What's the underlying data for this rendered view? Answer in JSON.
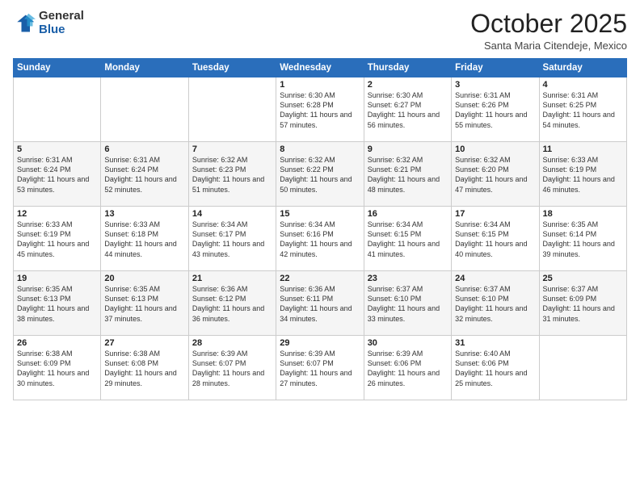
{
  "logo": {
    "general": "General",
    "blue": "Blue"
  },
  "title": "October 2025",
  "location": "Santa Maria Citendeje, Mexico",
  "days_of_week": [
    "Sunday",
    "Monday",
    "Tuesday",
    "Wednesday",
    "Thursday",
    "Friday",
    "Saturday"
  ],
  "weeks": [
    [
      {
        "day": "",
        "sunrise": "",
        "sunset": "",
        "daylight": ""
      },
      {
        "day": "",
        "sunrise": "",
        "sunset": "",
        "daylight": ""
      },
      {
        "day": "",
        "sunrise": "",
        "sunset": "",
        "daylight": ""
      },
      {
        "day": "1",
        "sunrise": "Sunrise: 6:30 AM",
        "sunset": "Sunset: 6:28 PM",
        "daylight": "Daylight: 11 hours and 57 minutes."
      },
      {
        "day": "2",
        "sunrise": "Sunrise: 6:30 AM",
        "sunset": "Sunset: 6:27 PM",
        "daylight": "Daylight: 11 hours and 56 minutes."
      },
      {
        "day": "3",
        "sunrise": "Sunrise: 6:31 AM",
        "sunset": "Sunset: 6:26 PM",
        "daylight": "Daylight: 11 hours and 55 minutes."
      },
      {
        "day": "4",
        "sunrise": "Sunrise: 6:31 AM",
        "sunset": "Sunset: 6:25 PM",
        "daylight": "Daylight: 11 hours and 54 minutes."
      }
    ],
    [
      {
        "day": "5",
        "sunrise": "Sunrise: 6:31 AM",
        "sunset": "Sunset: 6:24 PM",
        "daylight": "Daylight: 11 hours and 53 minutes."
      },
      {
        "day": "6",
        "sunrise": "Sunrise: 6:31 AM",
        "sunset": "Sunset: 6:24 PM",
        "daylight": "Daylight: 11 hours and 52 minutes."
      },
      {
        "day": "7",
        "sunrise": "Sunrise: 6:32 AM",
        "sunset": "Sunset: 6:23 PM",
        "daylight": "Daylight: 11 hours and 51 minutes."
      },
      {
        "day": "8",
        "sunrise": "Sunrise: 6:32 AM",
        "sunset": "Sunset: 6:22 PM",
        "daylight": "Daylight: 11 hours and 50 minutes."
      },
      {
        "day": "9",
        "sunrise": "Sunrise: 6:32 AM",
        "sunset": "Sunset: 6:21 PM",
        "daylight": "Daylight: 11 hours and 48 minutes."
      },
      {
        "day": "10",
        "sunrise": "Sunrise: 6:32 AM",
        "sunset": "Sunset: 6:20 PM",
        "daylight": "Daylight: 11 hours and 47 minutes."
      },
      {
        "day": "11",
        "sunrise": "Sunrise: 6:33 AM",
        "sunset": "Sunset: 6:19 PM",
        "daylight": "Daylight: 11 hours and 46 minutes."
      }
    ],
    [
      {
        "day": "12",
        "sunrise": "Sunrise: 6:33 AM",
        "sunset": "Sunset: 6:19 PM",
        "daylight": "Daylight: 11 hours and 45 minutes."
      },
      {
        "day": "13",
        "sunrise": "Sunrise: 6:33 AM",
        "sunset": "Sunset: 6:18 PM",
        "daylight": "Daylight: 11 hours and 44 minutes."
      },
      {
        "day": "14",
        "sunrise": "Sunrise: 6:34 AM",
        "sunset": "Sunset: 6:17 PM",
        "daylight": "Daylight: 11 hours and 43 minutes."
      },
      {
        "day": "15",
        "sunrise": "Sunrise: 6:34 AM",
        "sunset": "Sunset: 6:16 PM",
        "daylight": "Daylight: 11 hours and 42 minutes."
      },
      {
        "day": "16",
        "sunrise": "Sunrise: 6:34 AM",
        "sunset": "Sunset: 6:15 PM",
        "daylight": "Daylight: 11 hours and 41 minutes."
      },
      {
        "day": "17",
        "sunrise": "Sunrise: 6:34 AM",
        "sunset": "Sunset: 6:15 PM",
        "daylight": "Daylight: 11 hours and 40 minutes."
      },
      {
        "day": "18",
        "sunrise": "Sunrise: 6:35 AM",
        "sunset": "Sunset: 6:14 PM",
        "daylight": "Daylight: 11 hours and 39 minutes."
      }
    ],
    [
      {
        "day": "19",
        "sunrise": "Sunrise: 6:35 AM",
        "sunset": "Sunset: 6:13 PM",
        "daylight": "Daylight: 11 hours and 38 minutes."
      },
      {
        "day": "20",
        "sunrise": "Sunrise: 6:35 AM",
        "sunset": "Sunset: 6:13 PM",
        "daylight": "Daylight: 11 hours and 37 minutes."
      },
      {
        "day": "21",
        "sunrise": "Sunrise: 6:36 AM",
        "sunset": "Sunset: 6:12 PM",
        "daylight": "Daylight: 11 hours and 36 minutes."
      },
      {
        "day": "22",
        "sunrise": "Sunrise: 6:36 AM",
        "sunset": "Sunset: 6:11 PM",
        "daylight": "Daylight: 11 hours and 34 minutes."
      },
      {
        "day": "23",
        "sunrise": "Sunrise: 6:37 AM",
        "sunset": "Sunset: 6:10 PM",
        "daylight": "Daylight: 11 hours and 33 minutes."
      },
      {
        "day": "24",
        "sunrise": "Sunrise: 6:37 AM",
        "sunset": "Sunset: 6:10 PM",
        "daylight": "Daylight: 11 hours and 32 minutes."
      },
      {
        "day": "25",
        "sunrise": "Sunrise: 6:37 AM",
        "sunset": "Sunset: 6:09 PM",
        "daylight": "Daylight: 11 hours and 31 minutes."
      }
    ],
    [
      {
        "day": "26",
        "sunrise": "Sunrise: 6:38 AM",
        "sunset": "Sunset: 6:09 PM",
        "daylight": "Daylight: 11 hours and 30 minutes."
      },
      {
        "day": "27",
        "sunrise": "Sunrise: 6:38 AM",
        "sunset": "Sunset: 6:08 PM",
        "daylight": "Daylight: 11 hours and 29 minutes."
      },
      {
        "day": "28",
        "sunrise": "Sunrise: 6:39 AM",
        "sunset": "Sunset: 6:07 PM",
        "daylight": "Daylight: 11 hours and 28 minutes."
      },
      {
        "day": "29",
        "sunrise": "Sunrise: 6:39 AM",
        "sunset": "Sunset: 6:07 PM",
        "daylight": "Daylight: 11 hours and 27 minutes."
      },
      {
        "day": "30",
        "sunrise": "Sunrise: 6:39 AM",
        "sunset": "Sunset: 6:06 PM",
        "daylight": "Daylight: 11 hours and 26 minutes."
      },
      {
        "day": "31",
        "sunrise": "Sunrise: 6:40 AM",
        "sunset": "Sunset: 6:06 PM",
        "daylight": "Daylight: 11 hours and 25 minutes."
      },
      {
        "day": "",
        "sunrise": "",
        "sunset": "",
        "daylight": ""
      }
    ]
  ]
}
